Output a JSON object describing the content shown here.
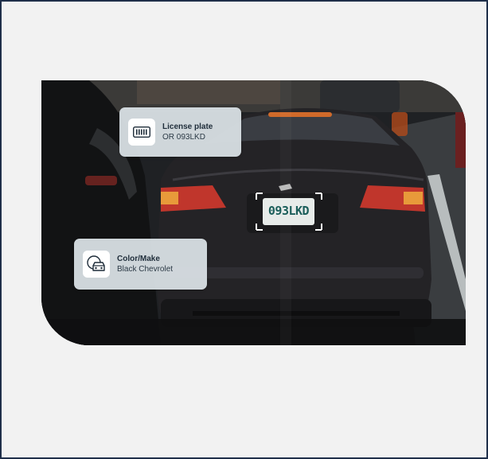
{
  "cards": {
    "license_plate": {
      "title": "License plate",
      "value": "OR 093LKD",
      "icon": "barcode-icon"
    },
    "color_make": {
      "title": "Color/Make",
      "value": "Black Chevrolet",
      "icon": "car-color-icon"
    }
  },
  "vehicle": {
    "plate_text": "093LKD"
  },
  "colors": {
    "frame_border": "#1f2f4a",
    "background": "#f2f2f2",
    "card_bg": "#d6dee2",
    "taillight": "#c0362c",
    "plate_text": "#1b5e5a"
  }
}
